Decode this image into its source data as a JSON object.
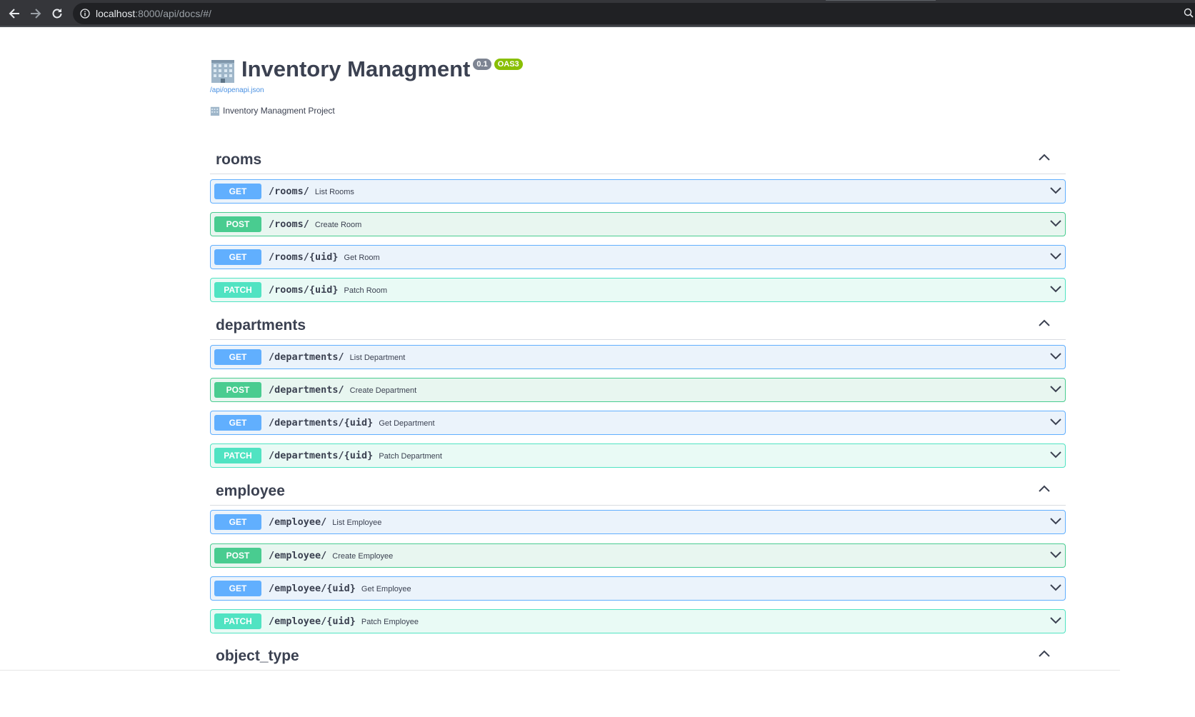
{
  "browser": {
    "url_host": "localhost",
    "url_path": ":8000/api/docs/#/",
    "icons": {
      "back": "arrow-left-icon",
      "forward": "arrow-right-icon",
      "reload": "reload-icon",
      "info": "info-icon",
      "zoom": "zoom-icon"
    }
  },
  "info": {
    "emoji": "🏢",
    "title": "Inventory Managment",
    "version": "0.1",
    "oas": "OAS3",
    "spec_link": "/api/openapi.json",
    "description": "Inventory Managment Project"
  },
  "colors": {
    "get": "#61affe",
    "post": "#49cc90",
    "patch": "#50e3c2",
    "text": "#3b4151",
    "link": "#4990e2"
  },
  "tags": [
    {
      "name": "rooms",
      "operations": [
        {
          "method": "GET",
          "path": "/rooms/",
          "summary": "List Rooms"
        },
        {
          "method": "POST",
          "path": "/rooms/",
          "summary": "Create Room"
        },
        {
          "method": "GET",
          "path": "/rooms/{uid}",
          "summary": "Get Room"
        },
        {
          "method": "PATCH",
          "path": "/rooms/{uid}",
          "summary": "Patch Room"
        }
      ]
    },
    {
      "name": "departments",
      "operations": [
        {
          "method": "GET",
          "path": "/departments/",
          "summary": "List Department"
        },
        {
          "method": "POST",
          "path": "/departments/",
          "summary": "Create Department"
        },
        {
          "method": "GET",
          "path": "/departments/{uid}",
          "summary": "Get Department"
        },
        {
          "method": "PATCH",
          "path": "/departments/{uid}",
          "summary": "Patch Department"
        }
      ]
    },
    {
      "name": "employee",
      "operations": [
        {
          "method": "GET",
          "path": "/employee/",
          "summary": "List Employee"
        },
        {
          "method": "POST",
          "path": "/employee/",
          "summary": "Create Employee"
        },
        {
          "method": "GET",
          "path": "/employee/{uid}",
          "summary": "Get Employee"
        },
        {
          "method": "PATCH",
          "path": "/employee/{uid}",
          "summary": "Patch Employee"
        }
      ]
    },
    {
      "name": "object_type",
      "operations": []
    }
  ]
}
